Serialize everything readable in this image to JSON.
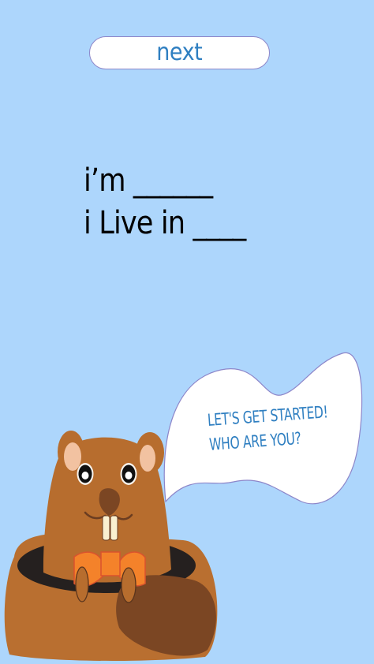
{
  "toolbar": {
    "next_label": "next"
  },
  "intro": {
    "line_1": "i’m ______",
    "line_2": "i Live in ____"
  },
  "speech": {
    "line_1": "LET'S GET STARTED!",
    "line_2": "WHO ARE YOU?"
  },
  "icons": {
    "mascot": "beaver-mascot-icon",
    "bow_tie": "bow-tie-icon"
  },
  "colors": {
    "background": "#add6fc",
    "accent_blue": "#2f7fc1",
    "button_border": "#8d86c9",
    "bubble_border": "#8d86c9",
    "beaver_brown": "#b76d2e",
    "beaver_dark": "#7b4623",
    "bow_orange": "#f4822a"
  }
}
